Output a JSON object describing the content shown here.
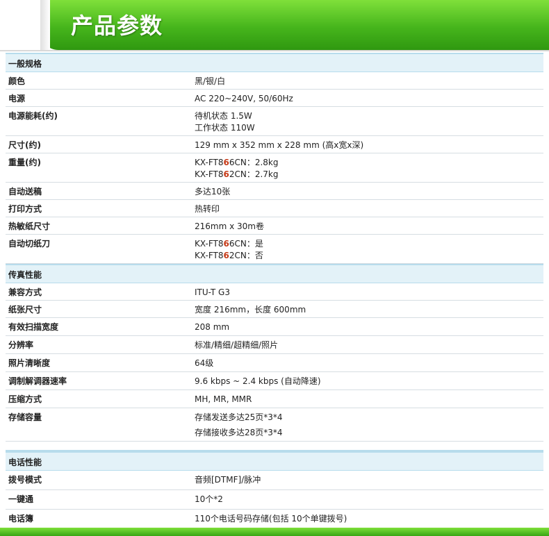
{
  "header": {
    "title": "产品参数"
  },
  "sections": [
    {
      "title": "一般规格",
      "rows": [
        {
          "label": "颜色",
          "lines": [
            "黑/银/白"
          ]
        },
        {
          "label": "电源",
          "lines": [
            "AC 220~240V, 50/60Hz"
          ]
        },
        {
          "label": "电源能耗(约)",
          "lines": [
            "待机状态 1.5W",
            "工作状态 110W"
          ]
        },
        {
          "label": "尺寸(约)",
          "lines": [
            "129 mm x 352 mm x 228 mm (高x宽x深)"
          ]
        },
        {
          "label": "重量(约)",
          "model_lines": [
            {
              "prefix": "KX-FT8",
              "hl": "6",
              "suffix": "6CN：2.8kg"
            },
            {
              "prefix": "KX-FT8",
              "hl": "6",
              "suffix": "2CN：2.7kg"
            }
          ]
        },
        {
          "label": "自动送稿",
          "lines": [
            "多达10张"
          ]
        },
        {
          "label": "打印方式",
          "lines": [
            "热转印"
          ]
        },
        {
          "label": "热敏纸尺寸",
          "lines": [
            "216mm x        30m卷"
          ]
        },
        {
          "label": "自动切纸刀",
          "model_lines": [
            {
              "prefix": "KX-FT8",
              "hl": "6",
              "suffix": "6CN：是"
            },
            {
              "prefix": "KX-FT8",
              "hl": "6",
              "suffix": "2CN：否"
            }
          ]
        }
      ]
    },
    {
      "title": "传真性能",
      "rows": [
        {
          "label": "兼容方式",
          "lines": [
            "ITU-T G3"
          ]
        },
        {
          "label": "纸张尺寸",
          "lines": [
            "宽度       216mm，长度       600mm"
          ]
        },
        {
          "label": "有效扫描宽度",
          "lines": [
            "208 mm"
          ]
        },
        {
          "label": "分辨率",
          "lines": [
            "标准/精细/超精细/照片"
          ]
        },
        {
          "label": "照片清晰度",
          "lines": [
            "64级"
          ]
        },
        {
          "label": "调制解调器速率",
          "lines": [
            "9.6 kbps ~ 2.4 kbps (自动降速)"
          ]
        },
        {
          "label": "压缩方式",
          "lines": [
            "MH, MR, MMR"
          ]
        },
        {
          "label": "存储容量",
          "lines": [
            "存储发送多达25页*3*4",
            "存储接收多达28页*3*4"
          ]
        }
      ]
    },
    {
      "title": "电话性能",
      "rows": [
        {
          "label": "拨号模式",
          "lines": [
            "音频[DTMF]/脉冲"
          ]
        },
        {
          "label": "一键通",
          "lines": [
            "10个*2"
          ]
        },
        {
          "label": "电话簿",
          "lines": [
            "110个电话号码存储(包括 10个单键拨号)"
          ]
        }
      ]
    }
  ]
}
